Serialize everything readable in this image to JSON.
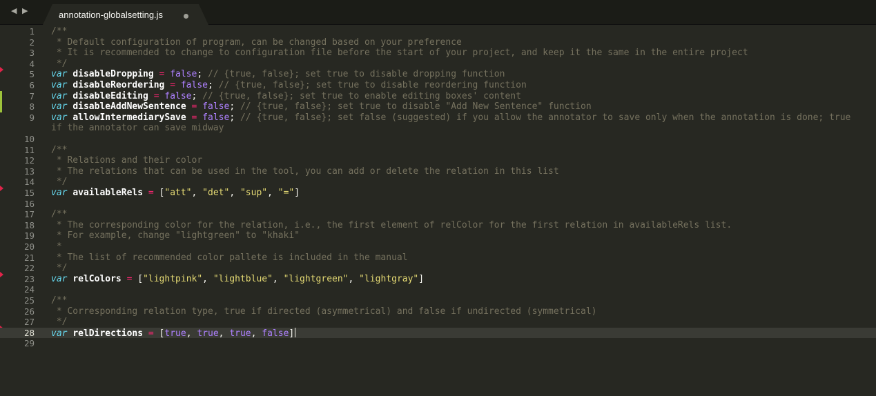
{
  "tab": {
    "filename": "annotation-globalsetting.js",
    "nav_back": "◀",
    "nav_forward": "▶"
  },
  "editor": {
    "current_line": 28,
    "lines": [
      {
        "num": "1",
        "tokens": [
          [
            "c",
            "/**"
          ]
        ]
      },
      {
        "num": "2",
        "tokens": [
          [
            "c",
            " * Default configuration of program, can be changed based on your preference"
          ]
        ]
      },
      {
        "num": "3",
        "tokens": [
          [
            "c",
            " * It is recommended to change to configuration file before the start of your project, and keep it the same in the entire project"
          ]
        ]
      },
      {
        "num": "4",
        "tokens": [
          [
            "c",
            " */"
          ]
        ]
      },
      {
        "num": "5",
        "tokens": [
          [
            "kw",
            "var"
          ],
          [
            "p",
            " "
          ],
          [
            "id",
            "disableDropping"
          ],
          [
            "p",
            " "
          ],
          [
            "op",
            "="
          ],
          [
            "p",
            " "
          ],
          [
            "bool",
            "false"
          ],
          [
            "p",
            ";"
          ],
          [
            "c",
            " // {true, false}; set true to disable dropping function"
          ]
        ]
      },
      {
        "num": "6",
        "tokens": [
          [
            "kw",
            "var"
          ],
          [
            "p",
            " "
          ],
          [
            "id",
            "disableReordering"
          ],
          [
            "p",
            " "
          ],
          [
            "op",
            "="
          ],
          [
            "p",
            " "
          ],
          [
            "bool",
            "false"
          ],
          [
            "p",
            ";"
          ],
          [
            "c",
            " // {true, false}; set true to disable reordering function"
          ]
        ]
      },
      {
        "num": "7",
        "tokens": [
          [
            "kw",
            "var"
          ],
          [
            "p",
            " "
          ],
          [
            "id",
            "disableEditing"
          ],
          [
            "p",
            " "
          ],
          [
            "op",
            "="
          ],
          [
            "p",
            " "
          ],
          [
            "bool",
            "false"
          ],
          [
            "p",
            ";"
          ],
          [
            "c",
            " // {true, false}; set true to enable editing boxes' content"
          ]
        ]
      },
      {
        "num": "8",
        "tokens": [
          [
            "kw",
            "var"
          ],
          [
            "p",
            " "
          ],
          [
            "id",
            "disableAddNewSentence"
          ],
          [
            "p",
            " "
          ],
          [
            "op",
            "="
          ],
          [
            "p",
            " "
          ],
          [
            "bool",
            "false"
          ],
          [
            "p",
            ";"
          ],
          [
            "c",
            " // {true, false}; set true to disable \"Add New Sentence\" function"
          ]
        ]
      },
      {
        "num": "9",
        "tokens": [
          [
            "kw",
            "var"
          ],
          [
            "p",
            " "
          ],
          [
            "id",
            "allowIntermediarySave"
          ],
          [
            "p",
            " "
          ],
          [
            "op",
            "="
          ],
          [
            "p",
            " "
          ],
          [
            "bool",
            "false"
          ],
          [
            "p",
            ";"
          ],
          [
            "c",
            " // {true, false}; set false (suggested) if you allow the annotator to save only when the annotation is done; true"
          ]
        ]
      },
      {
        "num": "",
        "tokens": [
          [
            "c",
            "if the annotator can save midway"
          ]
        ]
      },
      {
        "num": "10",
        "tokens": []
      },
      {
        "num": "11",
        "tokens": [
          [
            "c",
            "/**"
          ]
        ]
      },
      {
        "num": "12",
        "tokens": [
          [
            "c",
            " * Relations and their color"
          ]
        ]
      },
      {
        "num": "13",
        "tokens": [
          [
            "c",
            " * The relations that can be used in the tool, you can add or delete the relation in this list"
          ]
        ]
      },
      {
        "num": "14",
        "tokens": [
          [
            "c",
            " */"
          ]
        ]
      },
      {
        "num": "15",
        "tokens": [
          [
            "kw",
            "var"
          ],
          [
            "p",
            " "
          ],
          [
            "id",
            "availableRels"
          ],
          [
            "p",
            " "
          ],
          [
            "op",
            "="
          ],
          [
            "p",
            " ["
          ],
          [
            "str",
            "\"att\""
          ],
          [
            "p",
            ", "
          ],
          [
            "str",
            "\"det\""
          ],
          [
            "p",
            ", "
          ],
          [
            "str",
            "\"sup\""
          ],
          [
            "p",
            ", "
          ],
          [
            "str",
            "\"=\""
          ],
          [
            "p",
            "]"
          ]
        ]
      },
      {
        "num": "16",
        "tokens": []
      },
      {
        "num": "17",
        "tokens": [
          [
            "c",
            "/**"
          ]
        ]
      },
      {
        "num": "18",
        "tokens": [
          [
            "c",
            " * The corresponding color for the relation, i.e., the first element of relColor for the first relation in availableRels list."
          ]
        ]
      },
      {
        "num": "19",
        "tokens": [
          [
            "c",
            " * For example, change \"lightgreen\" to \"khaki\""
          ]
        ]
      },
      {
        "num": "20",
        "tokens": [
          [
            "c",
            " *"
          ]
        ]
      },
      {
        "num": "21",
        "tokens": [
          [
            "c",
            " * The list of recommended color pallete is included in the manual"
          ]
        ]
      },
      {
        "num": "22",
        "tokens": [
          [
            "c",
            " */"
          ]
        ]
      },
      {
        "num": "23",
        "tokens": [
          [
            "kw",
            "var"
          ],
          [
            "p",
            " "
          ],
          [
            "id",
            "relColors"
          ],
          [
            "p",
            " "
          ],
          [
            "op",
            "="
          ],
          [
            "p",
            " ["
          ],
          [
            "str",
            "\"lightpink\""
          ],
          [
            "p",
            ", "
          ],
          [
            "str",
            "\"lightblue\""
          ],
          [
            "p",
            ", "
          ],
          [
            "str",
            "\"lightgreen\""
          ],
          [
            "p",
            ", "
          ],
          [
            "str",
            "\"lightgray\""
          ],
          [
            "p",
            "]"
          ]
        ]
      },
      {
        "num": "24",
        "tokens": []
      },
      {
        "num": "25",
        "tokens": [
          [
            "c",
            "/**"
          ]
        ]
      },
      {
        "num": "26",
        "tokens": [
          [
            "c",
            " * Corresponding relation type, true if directed (asymmetrical) and false if undirected (symmetrical)"
          ]
        ]
      },
      {
        "num": "27",
        "tokens": [
          [
            "c",
            " */"
          ]
        ]
      },
      {
        "num": "28",
        "tokens": [
          [
            "kw",
            "var"
          ],
          [
            "p",
            " "
          ],
          [
            "id",
            "relDirections"
          ],
          [
            "p",
            " "
          ],
          [
            "op",
            "="
          ],
          [
            "p",
            " ["
          ],
          [
            "bool",
            "true"
          ],
          [
            "p",
            ", "
          ],
          [
            "bool",
            "true"
          ],
          [
            "p",
            ", "
          ],
          [
            "bool",
            "true"
          ],
          [
            "p",
            ", "
          ],
          [
            "bool",
            "false"
          ],
          [
            "p",
            "]"
          ]
        ]
      },
      {
        "num": "29",
        "tokens": []
      }
    ],
    "red_marks": [
      "5",
      "15",
      "23",
      "28"
    ],
    "green_marks": [
      "7",
      "8"
    ],
    "colors": {
      "background": "#272822",
      "comment": "#75715e",
      "keyword": "#66d9ef",
      "operator": "#f92672",
      "boolean": "#ae81ff",
      "string": "#e6db74"
    }
  }
}
